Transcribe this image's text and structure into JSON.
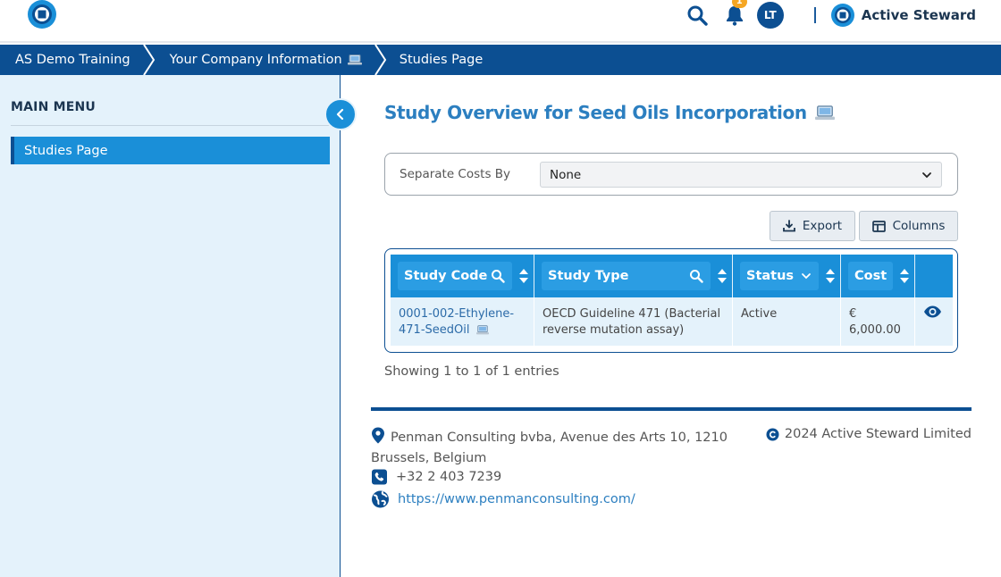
{
  "topbar": {
    "notification_count": "1",
    "avatar_initials": "LT",
    "brand_name": "Active Steward"
  },
  "breadcrumb": {
    "items": [
      "AS Demo Training",
      "Your Company Information",
      "Studies Page"
    ]
  },
  "sidebar": {
    "title": "MAIN MENU",
    "items": [
      {
        "label": "Studies Page",
        "active": true
      }
    ]
  },
  "main": {
    "title": "Study Overview for Seed Oils Incorporation",
    "filter": {
      "label": "Separate Costs By",
      "value": "None"
    },
    "buttons": {
      "export": "Export",
      "columns": "Columns"
    },
    "table": {
      "columns": [
        "Study Code",
        "Study Type",
        "Status",
        "Cost"
      ],
      "rows": [
        {
          "code_line1": "0001-002-Ethylene-",
          "code_line2": "471-SeedOil",
          "type_line1": "OECD Guideline 471 (Bacterial",
          "type_line2": "reverse mutation assay)",
          "status": "Active",
          "cost": "€ 6,000.00"
        }
      ]
    },
    "entries_info": "Showing 1 to 1 of 1 entries"
  },
  "footer": {
    "address_line1": "Penman Consulting bvba, Avenue des Arts 10, 1210",
    "address_line2": "Brussels, Belgium",
    "phone": "+32 2 403 7239",
    "website": "https://www.penmanconsulting.com/",
    "copyright": "2024 Active Steward Limited"
  },
  "colors": {
    "primary_dark": "#0c4f92",
    "primary": "#1a8fd8",
    "sidebar_bg": "#e4f2fb",
    "title": "#2c7fc0",
    "badge": "#f5a623"
  }
}
